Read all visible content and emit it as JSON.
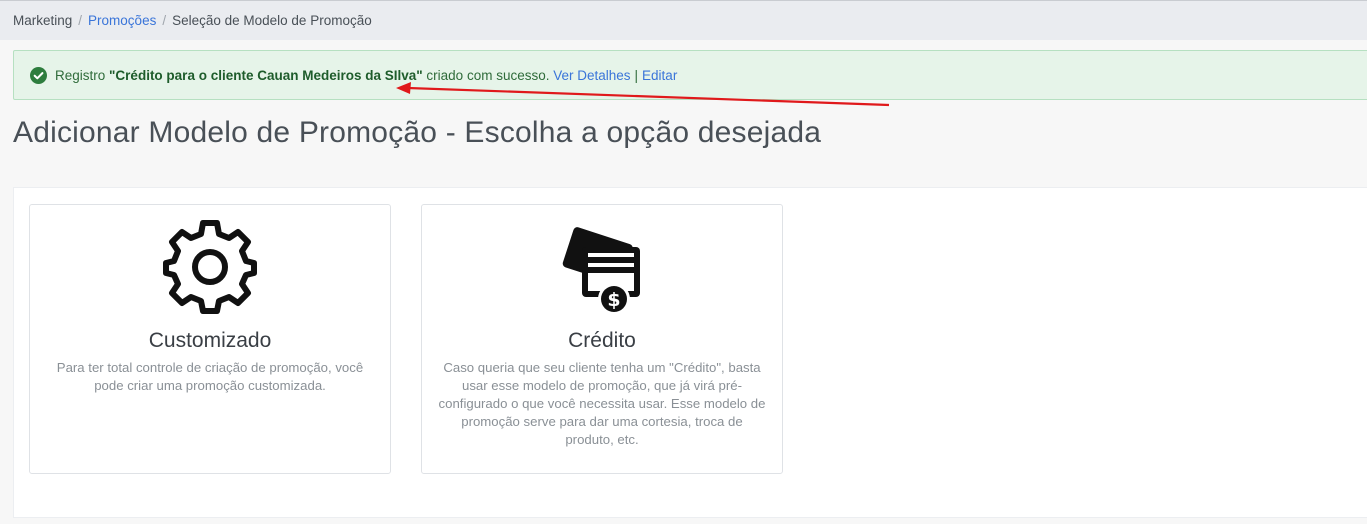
{
  "breadcrumb": {
    "items": [
      "Marketing",
      "Promoções",
      "Seleção de Modelo de Promoção"
    ],
    "separator": "/"
  },
  "alert": {
    "prefix": "Registro ",
    "record_name": "\"Crédito para o cliente Cauan Medeiros da SIlva\"",
    "suffix": " criado com sucesso. ",
    "details_link": "Ver Detalhes",
    "divider": "|",
    "edit_link": "Editar",
    "icon": "check-circle-icon",
    "color": "#2f6b3a"
  },
  "page": {
    "title": "Adicionar Modelo de Promoção - Escolha a opção desejada"
  },
  "cards": [
    {
      "icon": "gear-icon",
      "title": "Customizado",
      "description": "Para ter total controle de criação de promoção, você pode criar uma promoção customizada."
    },
    {
      "icon": "credit-card-money-icon",
      "title": "Crédito",
      "description": "Caso queria que seu cliente tenha um \"Crédito\", basta usar esse modelo de promoção, que já virá pré-configurado o que você necessita usar. Esse modelo de promoção serve para dar uma cortesia, troca de produto, etc."
    }
  ],
  "colors": {
    "link": "#3a75d9",
    "success_bg": "#e6f4e9",
    "annotation_arrow": "#e0191b"
  }
}
